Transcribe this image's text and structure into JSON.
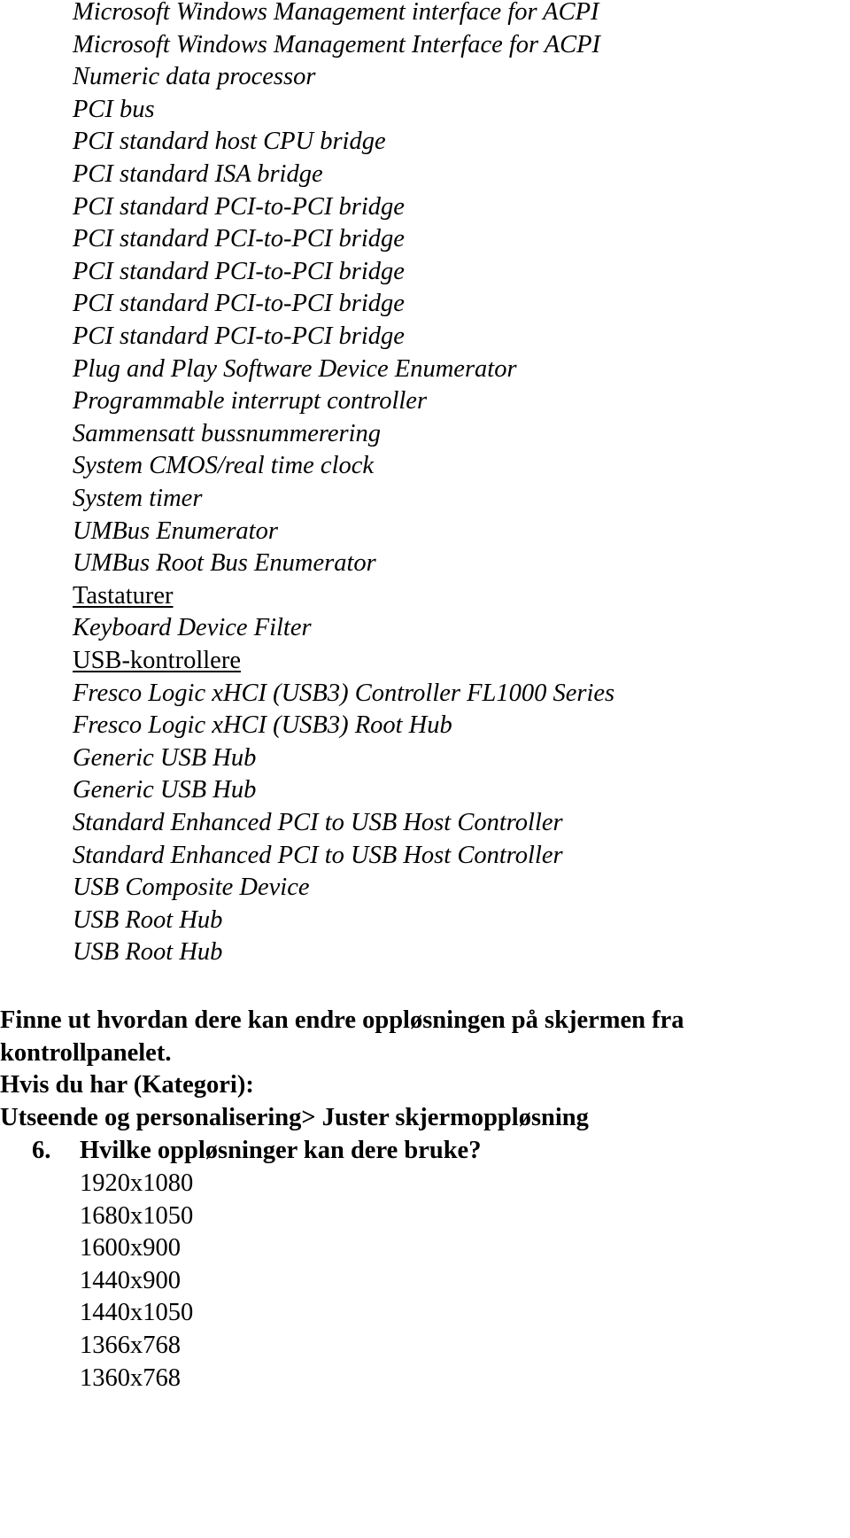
{
  "device_list": {
    "system_devices": [
      "Microsoft Windows Management interface for ACPI",
      "Microsoft Windows Management Interface for ACPI",
      "Numeric data processor",
      "PCI bus",
      "PCI standard host CPU bridge",
      "PCI standard ISA bridge",
      "PCI standard PCI-to-PCI bridge",
      "PCI standard PCI-to-PCI bridge",
      "PCI standard PCI-to-PCI bridge",
      "PCI standard PCI-to-PCI bridge",
      "PCI standard PCI-to-PCI bridge",
      "Plug and Play Software Device Enumerator",
      "Programmable interrupt controller",
      "Sammensatt bussnummerering",
      "System CMOS/real time clock",
      "System timer",
      "UMBus Enumerator",
      "UMBus Root Bus Enumerator"
    ],
    "keyboards_heading": "Tastaturer",
    "keyboards": [
      "Keyboard Device Filter"
    ],
    "usb_heading": "USB-kontrollere",
    "usb": [
      "Fresco Logic xHCI (USB3) Controller FL1000 Series",
      "Fresco Logic xHCI (USB3) Root Hub",
      "Generic USB Hub",
      "Generic USB Hub",
      "Standard Enhanced PCI to USB Host Controller",
      "Standard Enhanced PCI to USB Host Controller",
      "USB Composite Device",
      "USB Root Hub",
      "USB Root Hub"
    ]
  },
  "task": {
    "line1": "Finne ut hvordan dere kan endre oppløsningen på skjermen fra",
    "line2": "kontrollpanelet.",
    "line3": "Hvis du har (Kategori):",
    "line4": "Utseende og personalisering> Juster skjermoppløsning"
  },
  "question": {
    "number": "6.",
    "text": "Hvilke oppløsninger kan dere bruke?",
    "resolutions": [
      "1920x1080",
      "1680x1050",
      "1600x900",
      "1440x900",
      "1440x1050",
      "1366x768",
      "1360x768"
    ]
  }
}
